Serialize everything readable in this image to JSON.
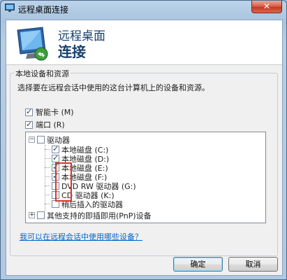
{
  "window": {
    "title": "远程桌面连接",
    "close_glyph": "✕"
  },
  "header": {
    "line1": "远程桌面",
    "line2": "连接"
  },
  "group": {
    "legend": "本地设备和资源",
    "description": "选择要在远程会话中使用的这台计算机上的设备和资源。"
  },
  "options": [
    {
      "label": "智能卡 (M)",
      "checked": true
    },
    {
      "label": "端口 (R)",
      "checked": true
    }
  ],
  "tree": {
    "drives": {
      "label": "驱动器",
      "checked": false,
      "expander": "−"
    },
    "items": [
      {
        "label": "本地磁盘 (C:)",
        "checked": true
      },
      {
        "label": "本地磁盘 (D:)",
        "checked": true
      },
      {
        "label": "本地磁盘 (E:)",
        "checked": true
      },
      {
        "label": "本地磁盘 (F:)",
        "checked": true
      },
      {
        "label": "DVD RW 驱动器 (G:)",
        "checked": false
      },
      {
        "label": "CD 驱动器 (K:)",
        "checked": false
      },
      {
        "label": "稍后插入的驱动器",
        "checked": false
      }
    ],
    "other": {
      "label": "其他支持的即插即用(PnP)设备",
      "checked": false,
      "expander": "+"
    }
  },
  "link_text": "我可以在远程会话中使用哪些设备？",
  "buttons": {
    "ok": "确定",
    "cancel": "取消"
  },
  "colors": {
    "highlight": "#e0312a",
    "title_blue": "#17406d",
    "link": "#0066cc"
  }
}
